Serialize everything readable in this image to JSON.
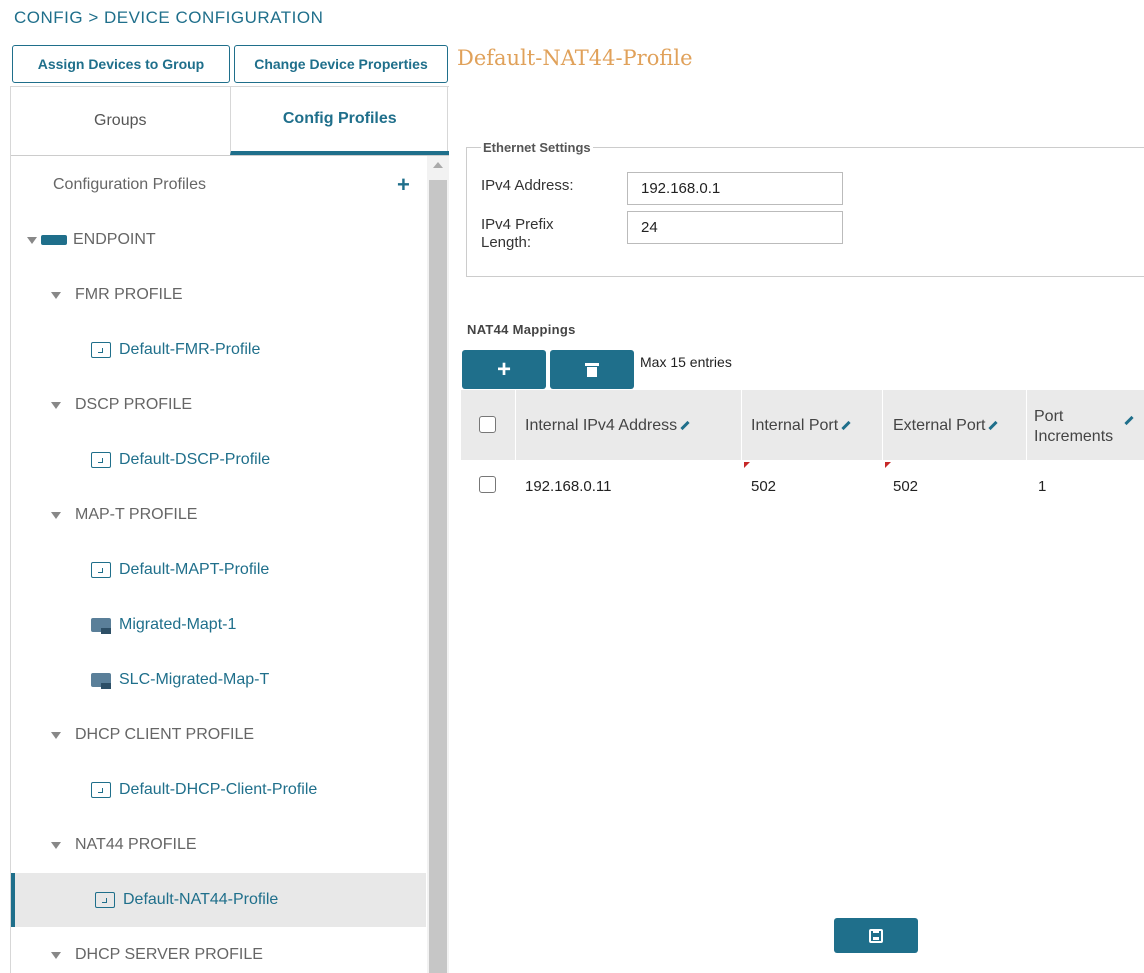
{
  "breadcrumb": "CONFIG > DEVICE CONFIGURATION",
  "toolbar": {
    "assign_label": "Assign Devices to Group",
    "change_label": "Change Device Properties"
  },
  "profile_title": "Default-NAT44-Profile",
  "tabs": {
    "groups": "Groups",
    "config_profiles": "Config Profiles"
  },
  "tree": {
    "header": "Configuration Profiles",
    "add_glyph": "+",
    "endpoint": "ENDPOINT",
    "fmr_profile": "FMR PROFILE",
    "default_fmr": "Default-FMR-Profile",
    "dscp_profile": "DSCP PROFILE",
    "default_dscp": "Default-DSCP-Profile",
    "mapt_profile": "MAP-T PROFILE",
    "default_mapt": "Default-MAPT-Profile",
    "migrated_mapt": "Migrated-Mapt-1",
    "slc_migrated": "SLC-Migrated-Map-T",
    "dhcp_client_profile": "DHCP CLIENT PROFILE",
    "default_dhcp_client": "Default-DHCP-Client-Profile",
    "nat44_profile": "NAT44 PROFILE",
    "default_nat44": "Default-NAT44-Profile",
    "dhcp_server_profile": "DHCP SERVER PROFILE"
  },
  "ethernet": {
    "legend": "Ethernet Settings",
    "ipv4_label": "IPv4 Address:",
    "ipv4_value": "192.168.0.1",
    "prefix_label_line1": "IPv4 Prefix",
    "prefix_label_line2": "Length:",
    "prefix_value": "24"
  },
  "nat44": {
    "title": "NAT44 Mappings",
    "add_glyph": "+",
    "max_entries": "Max 15 entries",
    "columns": {
      "internal_ip": "Internal IPv4 Address",
      "internal_port": "Internal Port",
      "external_port": "External Port",
      "port_inc_line1": "Port",
      "port_inc_line2": "Increments"
    },
    "rows": [
      {
        "internal_ip": "192.168.0.11",
        "internal_port": "502",
        "external_port": "502",
        "port_increments": "1"
      }
    ]
  },
  "colors": {
    "accent": "#1f6f8b",
    "title": "#e0a15a",
    "selected_bg": "#e8e8e8",
    "dirty_flag": "#c62828"
  }
}
